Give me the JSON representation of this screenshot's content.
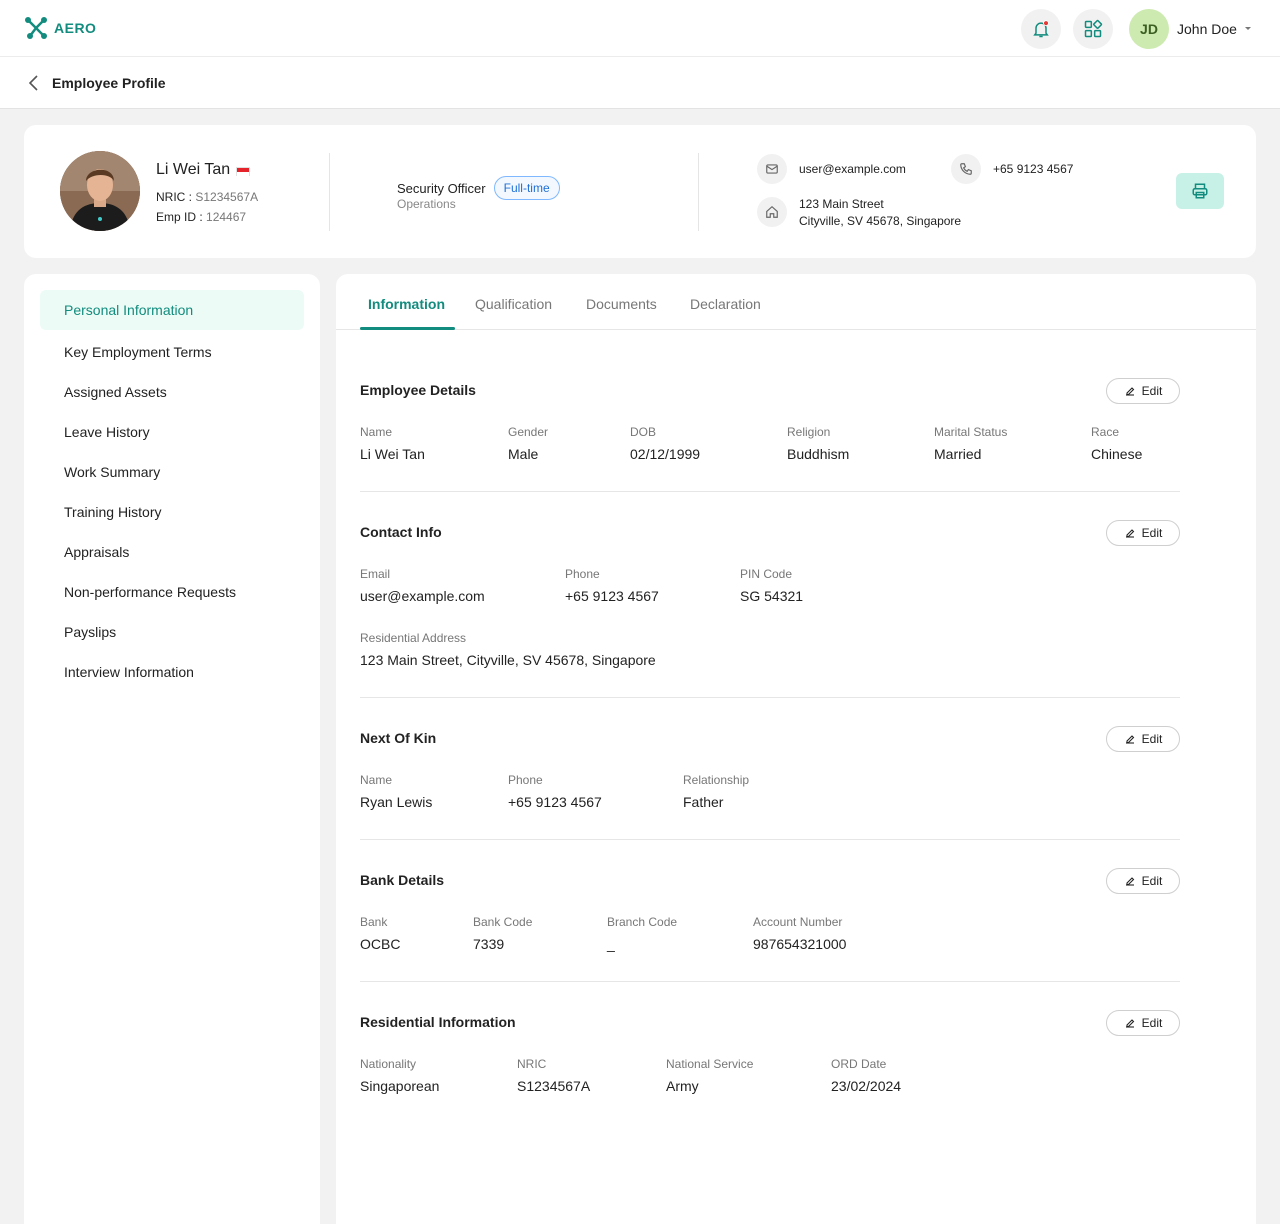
{
  "app": {
    "logo_text": "AERO"
  },
  "user": {
    "initials": "JD",
    "name": "John Doe"
  },
  "page": {
    "title": "Employee Profile"
  },
  "profile": {
    "name": "Li Wei Tan",
    "nric_label": "NRIC :",
    "nric": "S1234567A",
    "emp_id_label": "Emp ID :",
    "emp_id": "124467",
    "job_title": "Security Officer",
    "employment_type": "Full-time",
    "department": "Operations",
    "email": "user@example.com",
    "phone": "+65 9123 4567",
    "address_line1": "123 Main Street",
    "address_line2": "Cityville, SV 45678, Singapore"
  },
  "sidebar": {
    "items": [
      {
        "label": "Personal Information"
      },
      {
        "label": "Key Employment Terms"
      },
      {
        "label": "Assigned Assets"
      },
      {
        "label": "Leave History"
      },
      {
        "label": "Work Summary"
      },
      {
        "label": "Training History"
      },
      {
        "label": "Appraisals"
      },
      {
        "label": "Non-performance Requests"
      },
      {
        "label": "Payslips"
      },
      {
        "label": "Interview Information"
      }
    ]
  },
  "tabs": [
    {
      "label": "Information"
    },
    {
      "label": "Qualification"
    },
    {
      "label": "Documents"
    },
    {
      "label": "Declaration"
    }
  ],
  "edit_label": "Edit",
  "sections": {
    "employee_details": {
      "title": "Employee Details",
      "fields": [
        {
          "label": "Name",
          "value": "Li Wei Tan"
        },
        {
          "label": "Gender",
          "value": "Male"
        },
        {
          "label": "DOB",
          "value": "02/12/1999"
        },
        {
          "label": "Religion",
          "value": "Buddhism"
        },
        {
          "label": "Marital Status",
          "value": "Married"
        },
        {
          "label": "Race",
          "value": "Chinese"
        }
      ]
    },
    "contact_info": {
      "title": "Contact Info",
      "fields": [
        {
          "label": "Email",
          "value": "user@example.com"
        },
        {
          "label": "Phone",
          "value": "+65 9123 4567"
        },
        {
          "label": "PIN Code",
          "value": "SG 54321"
        },
        {
          "label": "Residential Address",
          "value": "123 Main Street, Cityville, SV 45678, Singapore"
        }
      ]
    },
    "next_of_kin": {
      "title": "Next Of Kin",
      "fields": [
        {
          "label": "Name",
          "value": "Ryan Lewis"
        },
        {
          "label": "Phone",
          "value": "+65 9123 4567"
        },
        {
          "label": "Relationship",
          "value": "Father"
        }
      ]
    },
    "bank_details": {
      "title": "Bank Details",
      "fields": [
        {
          "label": "Bank",
          "value": "OCBC"
        },
        {
          "label": "Bank Code",
          "value": "7339"
        },
        {
          "label": "Branch Code",
          "value": "_"
        },
        {
          "label": "Account Number",
          "value": "987654321000"
        }
      ]
    },
    "residential_information": {
      "title": "Residential Information",
      "fields": [
        {
          "label": "Nationality",
          "value": "Singaporean"
        },
        {
          "label": "NRIC",
          "value": "S1234567A"
        },
        {
          "label": "National Service",
          "value": "Army"
        },
        {
          "label": "ORD Date",
          "value": "23/02/2024"
        }
      ]
    }
  },
  "colors": {
    "accent": "#128c7e",
    "badge": "#1f6fd6",
    "avatar_bg": "#cdeab0",
    "print_bg": "#c7f1e6"
  }
}
